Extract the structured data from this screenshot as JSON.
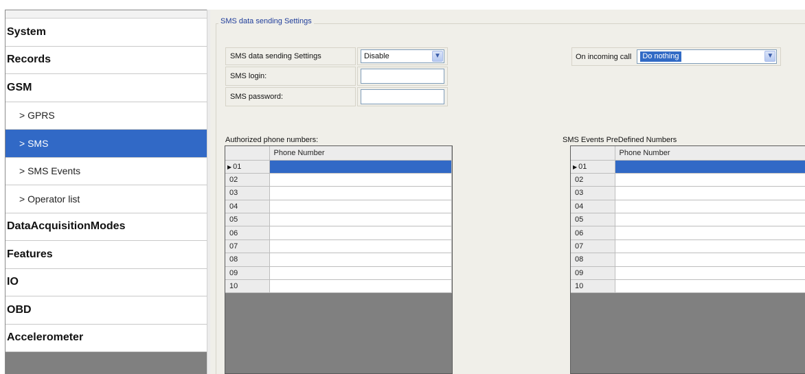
{
  "sidebar": {
    "items": [
      {
        "label": "System",
        "level": "top",
        "active": false
      },
      {
        "label": "Records",
        "level": "top",
        "active": false
      },
      {
        "label": "GSM",
        "level": "top",
        "active": false
      },
      {
        "label": "> GPRS",
        "level": "sub",
        "active": false
      },
      {
        "label": "> SMS",
        "level": "sub",
        "active": true
      },
      {
        "label": "> SMS Events",
        "level": "sub",
        "active": false
      },
      {
        "label": "> Operator list",
        "level": "sub",
        "active": false
      },
      {
        "label": "DataAcquisitionModes",
        "level": "top",
        "active": false
      },
      {
        "label": "Features",
        "level": "top",
        "active": false
      },
      {
        "label": "IO",
        "level": "top",
        "active": false
      },
      {
        "label": "OBD",
        "level": "top",
        "active": false
      },
      {
        "label": "Accelerometer",
        "level": "top",
        "active": false
      }
    ]
  },
  "group": {
    "title": "SMS data sending Settings"
  },
  "settings": {
    "sending_label": "SMS data sending Settings",
    "sending_value": "Disable",
    "login_label": "SMS login:",
    "login_value": "",
    "password_label": "SMS password:",
    "password_value": ""
  },
  "incoming_call": {
    "label": "On incoming call",
    "value": "Do nothing"
  },
  "authorized_grid": {
    "label": "Authorized phone numbers:",
    "column": "Phone Number",
    "rows": [
      "01",
      "02",
      "03",
      "04",
      "05",
      "06",
      "07",
      "08",
      "09",
      "10"
    ],
    "current_row": 0
  },
  "events_grid": {
    "label": "SMS Events PreDefined Numbers",
    "column": "Phone Number",
    "rows": [
      "01",
      "02",
      "03",
      "04",
      "05",
      "06",
      "07",
      "08",
      "09",
      "10"
    ],
    "current_row": 0
  },
  "colors": {
    "selection": "#3169c6",
    "group_title": "#1f3d9a",
    "panel_bg": "#f0efe9"
  },
  "icons": {
    "dropdown": "chevron-down-icon",
    "current_row": "triangle-right-icon"
  }
}
